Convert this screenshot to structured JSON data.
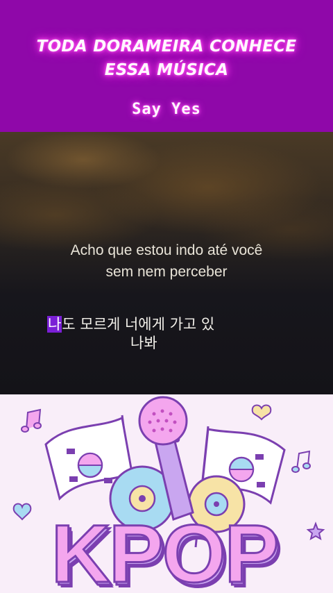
{
  "banner": {
    "title": "TODA DORAMEIRA CONHECE\nESSA MÚSICA",
    "song": "Say  Yes"
  },
  "video": {
    "subtitle_pt": "Acho que estou indo até você\nsem nem perceber",
    "subtitle_ko_highlight": "나",
    "subtitle_ko_rest": "도 모르게 너에게 가고 있",
    "subtitle_ko_line2": "나봐"
  },
  "art": {
    "logo_text": "KPOP",
    "icons": [
      "music-note-icon",
      "heart-icon",
      "microphone-icon",
      "flag-icon",
      "vinyl-record-icon",
      "star-icon"
    ]
  },
  "colors": {
    "banner_bg": "#8f08a9",
    "glow": "#ff3df0",
    "highlight": "#7a1fd6",
    "kpop_fill": "#f4a6ee",
    "kpop_outline": "#7b3fb0"
  }
}
